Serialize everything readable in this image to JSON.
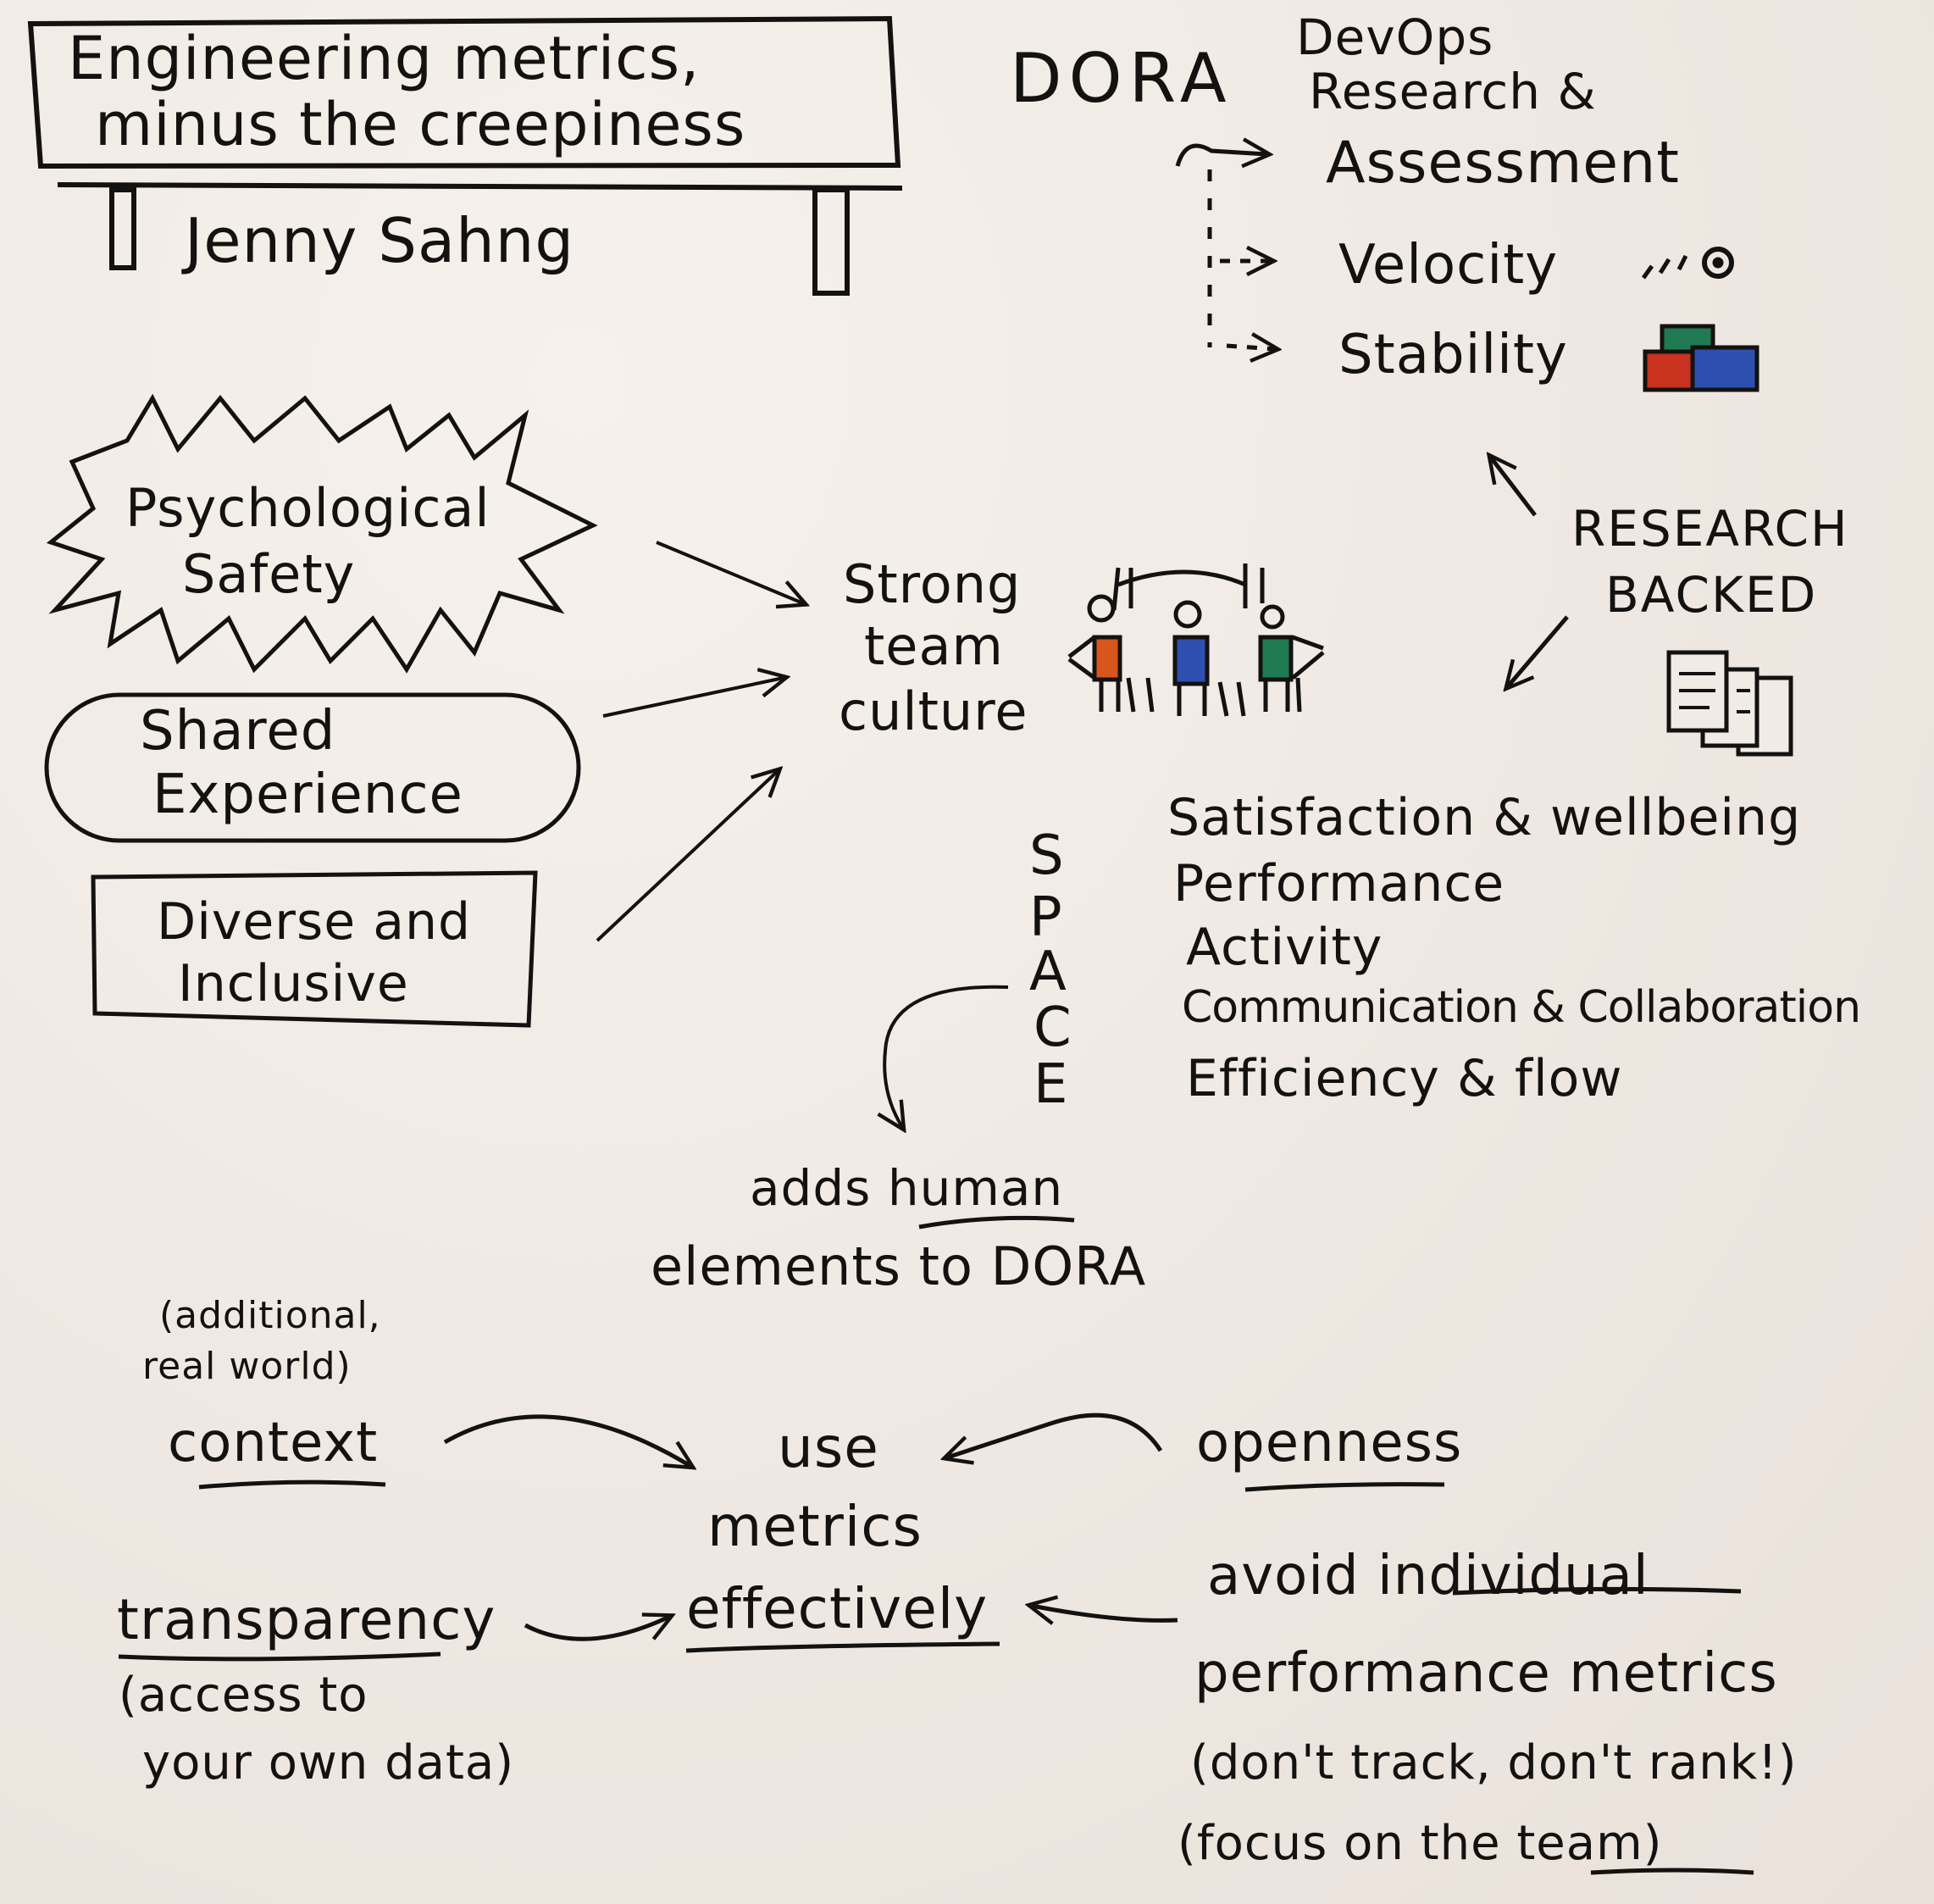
{
  "header": {
    "title_line1": "Engineering metrics,",
    "title_line2": "minus the creepiness",
    "speaker": "Jenny Sahng"
  },
  "dora": {
    "acronym": "DORA",
    "expansion_line1": "DevOps",
    "expansion_line2": "Research &",
    "expansion_line3": "Assessment",
    "velocity": "Velocity",
    "stability": "Stability"
  },
  "research": {
    "line1": "RESEARCH",
    "line2": "BACKED"
  },
  "culture": {
    "psych_safety_line1": "Psychological",
    "psych_safety_line2": "Safety",
    "shared_line1": "Shared",
    "shared_line2": "Experience",
    "diverse_line1": "Diverse and",
    "diverse_line2": "Inclusive",
    "strong_line1": "Strong",
    "strong_line2": "team",
    "strong_line3": "culture"
  },
  "space": {
    "letters": [
      "S",
      "P",
      "A",
      "C",
      "E"
    ],
    "items": [
      "Satisfaction & wellbeing",
      "Performance",
      "Activity",
      "Communication & Collaboration",
      "Efficiency & flow"
    ],
    "note_line1": "adds human",
    "note_line2": "elements to DORA"
  },
  "effective": {
    "context_note_line1": "(additional,",
    "context_note_line2": "real world)",
    "context": "context",
    "center_line1": "use",
    "center_line2": "metrics",
    "center_line3": "effectively",
    "openness": "openness",
    "transparency": "transparency",
    "transparency_note_line1": "(access to",
    "transparency_note_line2": "your own data)",
    "avoid_line1": "avoid individual",
    "avoid_line2": "performance metrics",
    "avoid_line3": "(don't track, don't rank!)",
    "avoid_line4": "(focus on the team)"
  },
  "colors": {
    "ink": "#141210",
    "paper": "#f1ebe6",
    "orange": "#d8561c",
    "blue": "#2d4fb0",
    "green": "#1f7a52",
    "red": "#c8321f"
  },
  "icons": [
    "board-sign-icon",
    "gauge-icon",
    "stacked-blocks-icon",
    "team-people-icon",
    "documents-icon"
  ]
}
